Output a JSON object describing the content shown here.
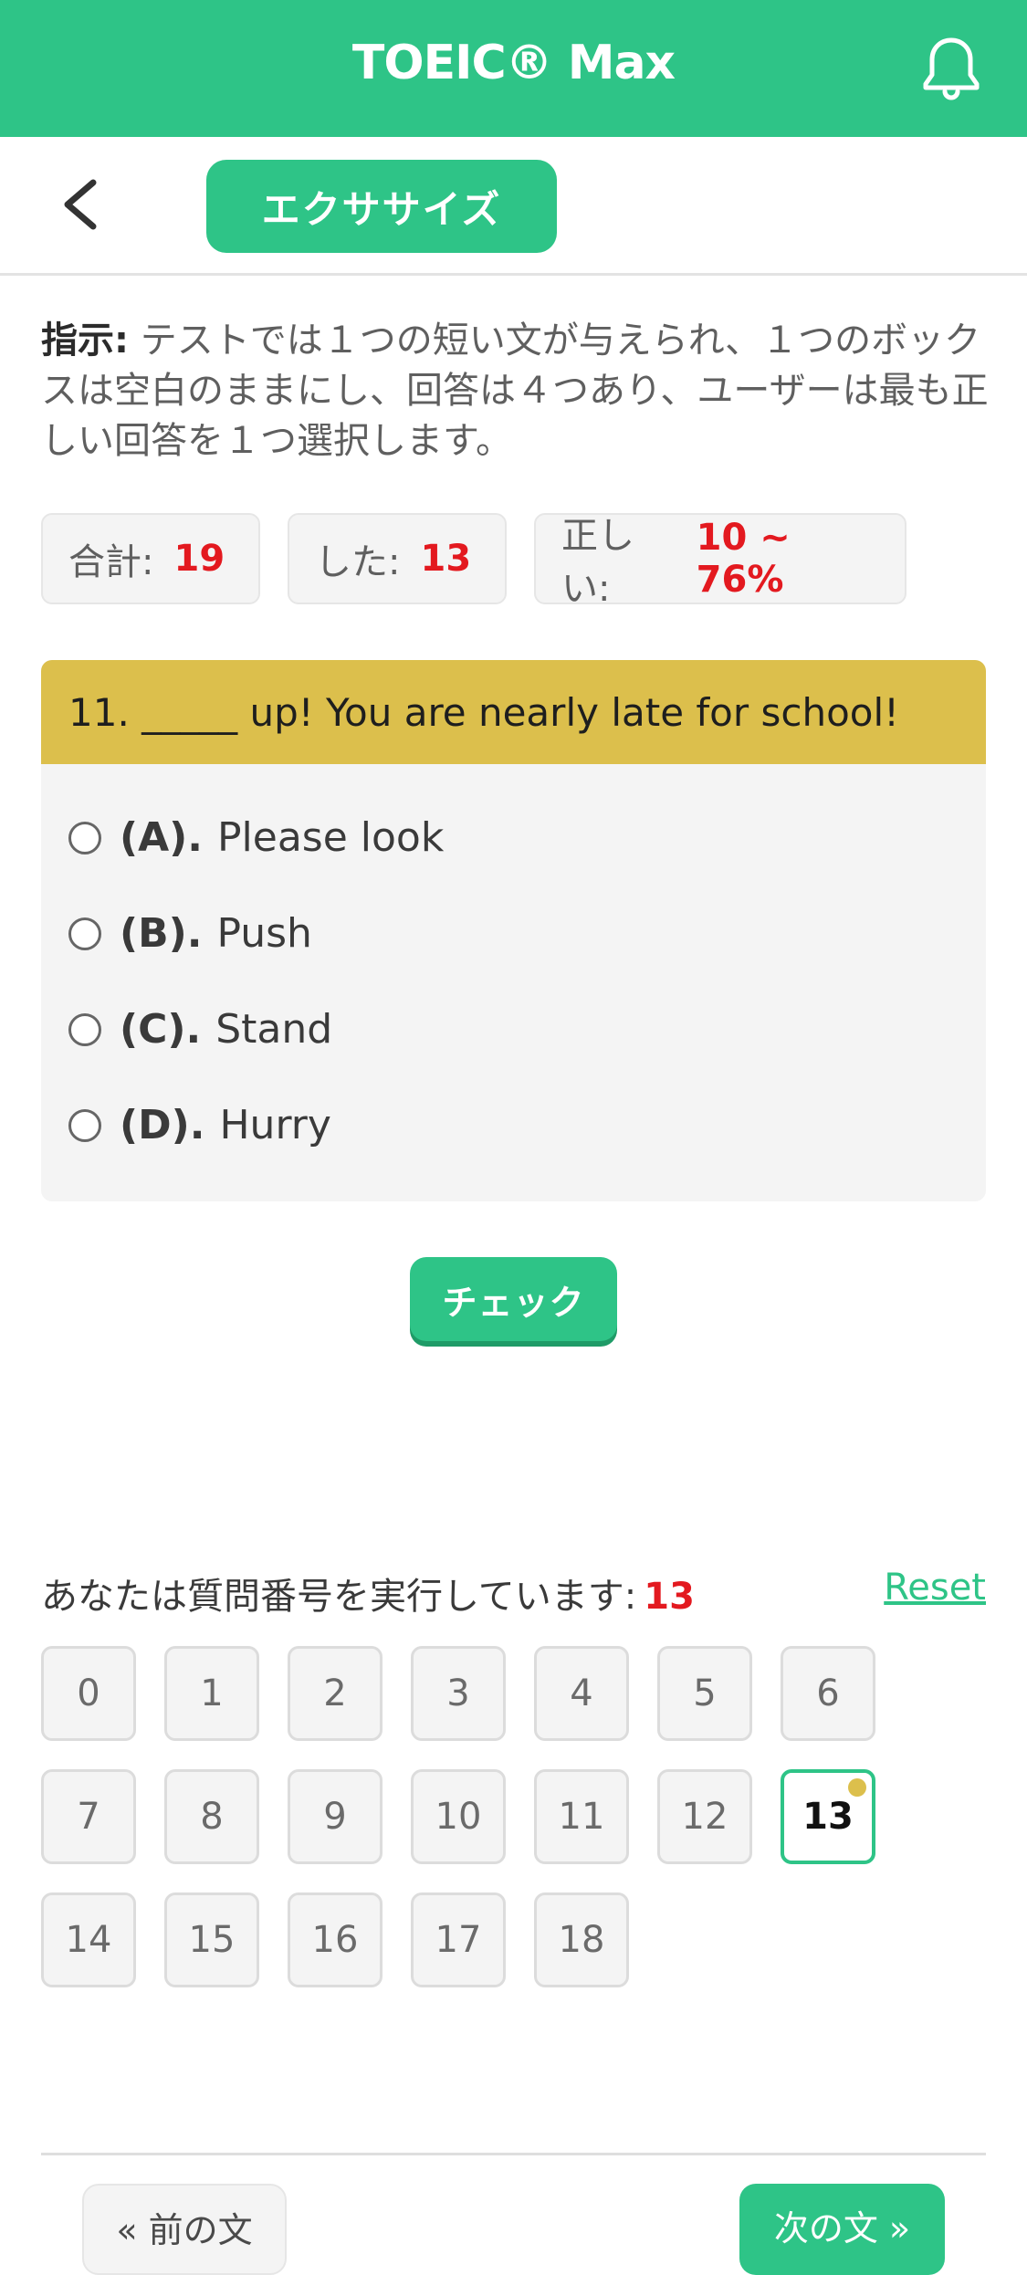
{
  "header": {
    "title": "TOEIC® Max",
    "bell_icon": "bell-icon"
  },
  "nav": {
    "back_icon": "chevron-left-icon",
    "exercise_label": "エクササイズ"
  },
  "instructions": {
    "label": "指示:",
    "text": " テストでは１つの短い文が与えられ、１つのボックスは空白のままにし、回答は４つあり、ユーザーは最も正しい回答を１つ選択します。"
  },
  "stats": {
    "total_label": "合計:",
    "total_value": "19",
    "done_label": "した:",
    "done_value": "13",
    "correct_label": "正しい:",
    "correct_value": "10 ~ 76%"
  },
  "question": {
    "text": "11. _____ up! You are nearly late for school!",
    "options": [
      {
        "label": "(A).",
        "text": "Please look"
      },
      {
        "label": "(B).",
        "text": "Push"
      },
      {
        "label": "(C).",
        "text": "Stand"
      },
      {
        "label": "(D).",
        "text": "Hurry"
      }
    ]
  },
  "check_label": "チェック",
  "progress": {
    "running_label": "あなたは質問番号を実行しています:",
    "running_number": "13",
    "reset_label": "Reset",
    "numbers": [
      "0",
      "1",
      "2",
      "3",
      "4",
      "5",
      "6",
      "7",
      "8",
      "9",
      "10",
      "11",
      "12",
      "13",
      "14",
      "15",
      "16",
      "17",
      "18"
    ],
    "active": "13"
  },
  "footer": {
    "prev_label": "« 前の文",
    "next_label": "次の文 »"
  },
  "colors": {
    "brand": "#2ec487",
    "accent_red": "#e3191f",
    "question_header": "#dcbf4c"
  }
}
